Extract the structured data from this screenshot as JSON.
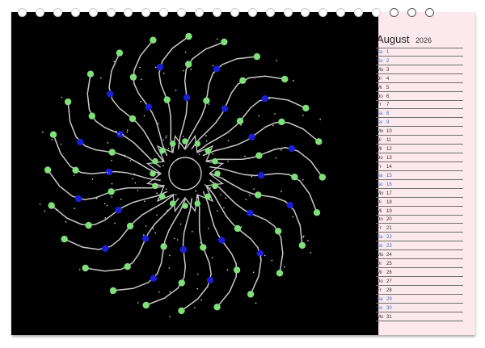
{
  "month_header": {
    "month": "August",
    "year": "2026"
  },
  "days": [
    {
      "name": "Sa",
      "num": "1",
      "weekend": true
    },
    {
      "name": "So",
      "num": "2",
      "weekend": true
    },
    {
      "name": "Mo",
      "num": "3",
      "weekend": false
    },
    {
      "name": "Di",
      "num": "4",
      "weekend": false
    },
    {
      "name": "Mi",
      "num": "5",
      "weekend": false
    },
    {
      "name": "Do",
      "num": "6",
      "weekend": false
    },
    {
      "name": "Fr",
      "num": "7",
      "weekend": false
    },
    {
      "name": "Sa",
      "num": "8",
      "weekend": true
    },
    {
      "name": "So",
      "num": "9",
      "weekend": true
    },
    {
      "name": "Mo",
      "num": "10",
      "weekend": false
    },
    {
      "name": "Di",
      "num": "11",
      "weekend": false
    },
    {
      "name": "Mi",
      "num": "12",
      "weekend": false
    },
    {
      "name": "Do",
      "num": "13",
      "weekend": false
    },
    {
      "name": "Fr",
      "num": "14",
      "weekend": false
    },
    {
      "name": "Sa",
      "num": "15",
      "weekend": true
    },
    {
      "name": "So",
      "num": "16",
      "weekend": true
    },
    {
      "name": "Mo",
      "num": "17",
      "weekend": false
    },
    {
      "name": "Di",
      "num": "18",
      "weekend": false
    },
    {
      "name": "Mi",
      "num": "19",
      "weekend": false
    },
    {
      "name": "Do",
      "num": "20",
      "weekend": false
    },
    {
      "name": "Fr",
      "num": "21",
      "weekend": false
    },
    {
      "name": "Sa",
      "num": "22",
      "weekend": true
    },
    {
      "name": "So",
      "num": "23",
      "weekend": true
    },
    {
      "name": "Mo",
      "num": "24",
      "weekend": false
    },
    {
      "name": "Di",
      "num": "25",
      "weekend": false
    },
    {
      "name": "Mi",
      "num": "26",
      "weekend": false
    },
    {
      "name": "Do",
      "num": "27",
      "weekend": false
    },
    {
      "name": "Fr",
      "num": "28",
      "weekend": false
    },
    {
      "name": "Sa",
      "num": "29",
      "weekend": true
    },
    {
      "name": "So",
      "num": "30",
      "weekend": true
    },
    {
      "name": "Mo",
      "num": "31",
      "weekend": false
    }
  ],
  "colors": {
    "artwork_background": "#000000",
    "panel_background": "#fbe9ee",
    "weekend_text": "#3e6fb5",
    "mandala_strands": "#c8c8c8",
    "mandala_green": "#7fe07a",
    "mandala_blue": "#1a1fd6"
  },
  "icons": [
    "binding-ring-icon",
    "mandala-artwork"
  ]
}
